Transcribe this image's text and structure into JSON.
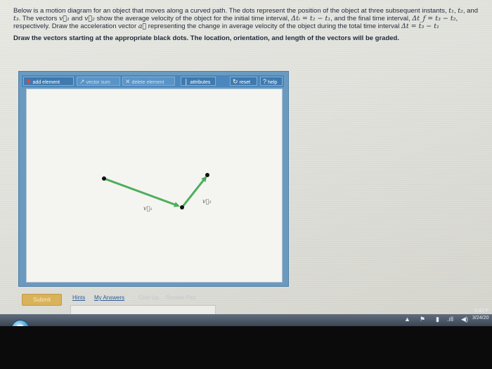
{
  "problem": {
    "p1": "Below is a motion diagram for an object that moves along a curved path. The dots represent the position of the object at three subsequent instants,",
    "p2a": "t",
    "p2b": ", and",
    "p2c": ". The vectors",
    "p2d": "and",
    "p2e": "show the average velocity of the object for the initial time interval,",
    "p2f": ", and the final time interval,",
    "p3a": ", respectively. Draw the acceleration vector",
    "p3b": "representing the change in average velocity of the object during the total time interval",
    "t1": "t₁",
    "t2": "t₂",
    "t3": "t₃",
    "v1": "v⃗₁",
    "v2": "v⃗₂",
    "a": "a⃗",
    "dti": "Δtᵢ = t₂ − t₁",
    "dtf": "Δt_f = t₃ − t₂",
    "dt": "Δt = t₃ − t₁",
    "instruction": "Draw the vectors starting at the appropriate black dots. The location, orientation, and length of the vectors will be graded."
  },
  "toolbar": {
    "add_element": "add element",
    "vector_sum": "vector sum",
    "delete_element": "delete element",
    "attributes": "attributes",
    "reset": "reset",
    "help": "help"
  },
  "canvas": {
    "v1_label": "v⃗₁",
    "v2_label": "v⃗₂",
    "arrow_color": "#4cae5a",
    "dot_color": "#111111"
  },
  "footer": {
    "submit": "Submit",
    "hints": "Hints",
    "my_answers": "My Answers",
    "give_up": "Give Up",
    "review_part": "Review Part"
  },
  "taskbar": {
    "start_label": "S",
    "time": "2:42 P",
    "date": "3/24/20"
  }
}
